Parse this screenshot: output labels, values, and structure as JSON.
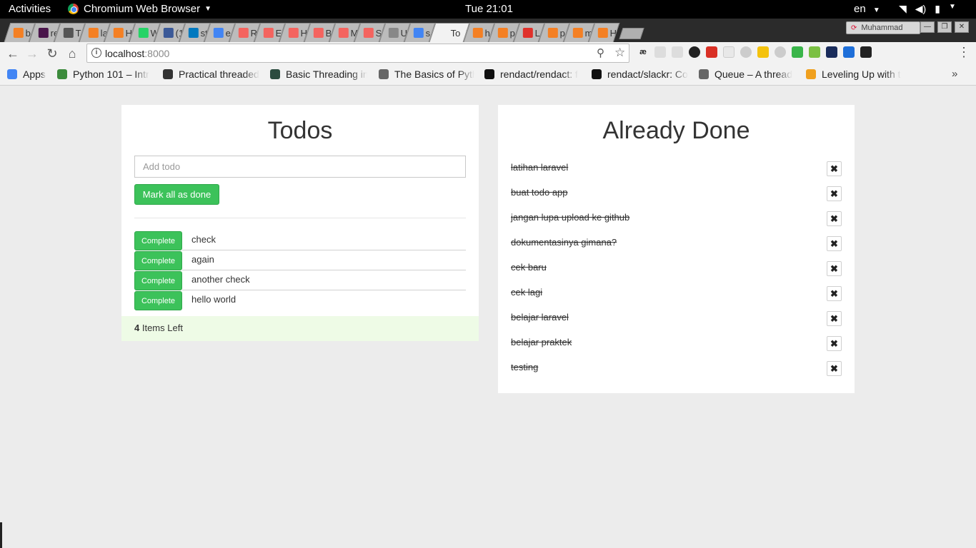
{
  "system_bar": {
    "activities": "Activities",
    "app_name": "Chromium Web Browser",
    "clock": "Tue 21:01",
    "language": "en"
  },
  "browser": {
    "tabs": [
      {
        "title": "b",
        "icon": "stackoverflow-icon",
        "color": "#f48024"
      },
      {
        "title": "re",
        "icon": "slack-icon",
        "color": "#4a154b"
      },
      {
        "title": "T",
        "icon": "send-icon",
        "color": "#555555"
      },
      {
        "title": "la",
        "icon": "stackoverflow-icon",
        "color": "#f48024"
      },
      {
        "title": "H",
        "icon": "stackoverflow-icon",
        "color": "#f48024"
      },
      {
        "title": "W",
        "icon": "whatsapp-icon",
        "color": "#25d366"
      },
      {
        "title": "(1",
        "icon": "facebook-icon",
        "color": "#3b5998"
      },
      {
        "title": "st",
        "icon": "trello-icon",
        "color": "#0079bf"
      },
      {
        "title": "e",
        "icon": "google-icon",
        "color": "#4285f4"
      },
      {
        "title": "R",
        "icon": "laravel-icon",
        "color": "#f4645f"
      },
      {
        "title": "E",
        "icon": "laravel-icon",
        "color": "#f4645f"
      },
      {
        "title": "H",
        "icon": "laravel-icon",
        "color": "#f4645f"
      },
      {
        "title": "B",
        "icon": "laravel-icon",
        "color": "#f4645f"
      },
      {
        "title": "M",
        "icon": "laravel-icon",
        "color": "#f4645f"
      },
      {
        "title": "S",
        "icon": "laravel-icon",
        "color": "#f4645f"
      },
      {
        "title": "U",
        "icon": "page-icon",
        "color": "#888888"
      },
      {
        "title": "s",
        "icon": "google-icon",
        "color": "#4285f4"
      },
      {
        "title": "To",
        "icon": "page-icon",
        "color": "#f2f2f2",
        "active": true
      },
      {
        "title": "h",
        "icon": "stackoverflow-icon",
        "color": "#f48024"
      },
      {
        "title": "p",
        "icon": "stackoverflow-icon",
        "color": "#f48024"
      },
      {
        "title": "L",
        "icon": "ln-icon",
        "color": "#e0312b"
      },
      {
        "title": "p",
        "icon": "stackoverflow-icon",
        "color": "#f48024"
      },
      {
        "title": "m",
        "icon": "stackoverflow-icon",
        "color": "#f48024"
      },
      {
        "title": "H",
        "icon": "stackoverflow-icon",
        "color": "#f48024"
      }
    ],
    "profile_name": "Muhammad",
    "url_host": "localhost",
    "url_port": ":8000"
  },
  "bookmarks": [
    {
      "label": "Apps",
      "icon": "apps-grid-icon",
      "color": "#4285f4"
    },
    {
      "label": "Python 101 – Intr",
      "icon": "python-icon",
      "color": "#3c8b3c"
    },
    {
      "label": "Practical threaded",
      "icon": "bird-icon",
      "color": "#333333"
    },
    {
      "label": "Basic Threading in",
      "icon": "grid-icon",
      "color": "#2b4c3f"
    },
    {
      "label": "The Basics of Pyth",
      "icon": "page-icon",
      "color": "#666666"
    },
    {
      "label": "rendact/rendact: f",
      "icon": "github-icon",
      "color": "#111111"
    },
    {
      "label": "rendact/slackr: Co",
      "icon": "github-icon",
      "color": "#111111"
    },
    {
      "label": "Queue – A thread",
      "icon": "page-icon",
      "color": "#666666"
    },
    {
      "label": "Leveling Up with t",
      "icon": "asterisk-icon",
      "color": "#f0a01e"
    }
  ],
  "todos": {
    "title": "Todos",
    "input_placeholder": "Add todo",
    "mark_all_label": "Mark all as done",
    "complete_label": "Complete",
    "items": [
      "check",
      "again",
      "another check",
      "hello world"
    ],
    "items_left_count": "4",
    "items_left_label": " Items Left"
  },
  "done": {
    "title": "Already Done",
    "items": [
      "latihan laravel",
      "buat todo app",
      "jangan lupa upload ke github",
      "dokumentasinya gimana?",
      "cek baru",
      "cek lagi",
      "belajar laravel",
      "belajar praktek",
      "testing"
    ],
    "delete_icon": "close-icon"
  },
  "colors": {
    "accent_green": "#3cc25a",
    "footer_bg": "#eefbe6",
    "page_bg": "#ececec"
  }
}
